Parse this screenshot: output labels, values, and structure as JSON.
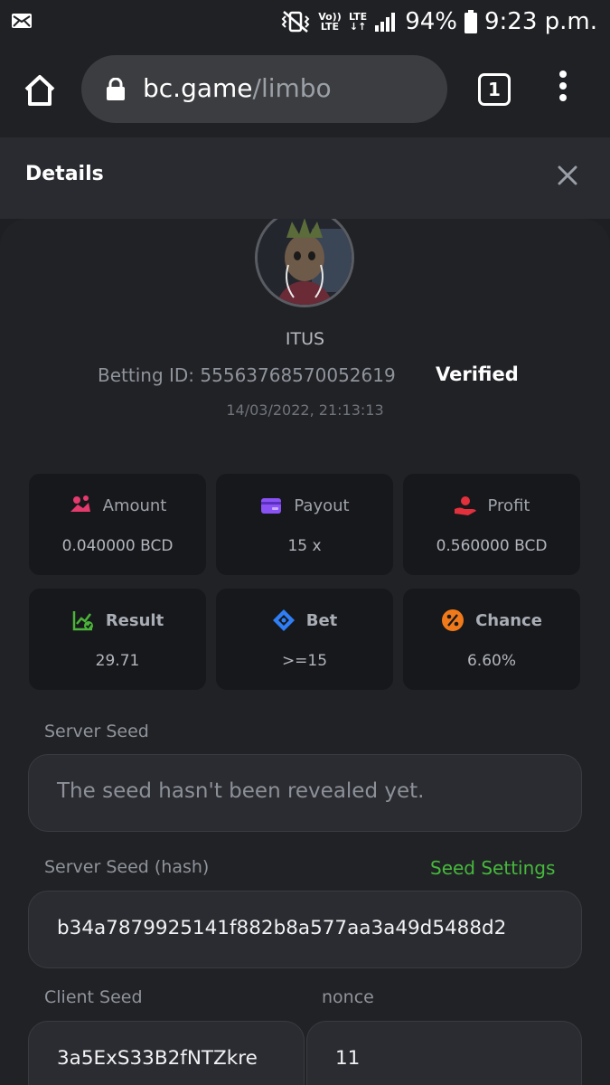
{
  "status_bar": {
    "battery": "94%",
    "time": "9:23 p.m.",
    "volte": "Vo)) LTE",
    "lte": "LTE"
  },
  "browser": {
    "url_domain": "bc.game",
    "url_path": "/limbo",
    "tab_count": "1"
  },
  "details": {
    "title": "Details",
    "username": "ITUS",
    "betting_id": "Betting ID: 55563768570052619",
    "verified": "Verified",
    "datetime": "14/03/2022, 21:13:13"
  },
  "stats": [
    {
      "label": "Amount",
      "value": "0.040000 BCD",
      "icon": "coins-icon",
      "color": "#e53a6d"
    },
    {
      "label": "Payout",
      "value": "15 x",
      "icon": "wallet-icon",
      "color": "#8a52f5"
    },
    {
      "label": "Profit",
      "value": "0.560000 BCD",
      "icon": "profit-hand-icon",
      "color": "#e3303d"
    },
    {
      "label": "Result",
      "value": "29.71",
      "icon": "chart-check-icon",
      "color": "#4bb43a"
    },
    {
      "label": "Bet",
      "value": ">=15",
      "icon": "ticket-icon",
      "color": "#2f7ef5"
    },
    {
      "label": "Chance",
      "value": "6.60%",
      "icon": "percent-icon",
      "color": "#f07a1a"
    }
  ],
  "seeds": {
    "server_seed_label": "Server Seed",
    "server_seed_value": "The seed hasn't been revealed yet.",
    "server_seed_hash_label": "Server Seed (hash)",
    "seed_settings_link": "Seed Settings",
    "server_seed_hash_value": "b34a7879925141f882b8a577aa3a49d5488d2",
    "client_seed_label": "Client Seed",
    "client_seed_value": "3a5ExS33B2fNTZkre",
    "nonce_label": "nonce",
    "nonce_value": "11"
  }
}
